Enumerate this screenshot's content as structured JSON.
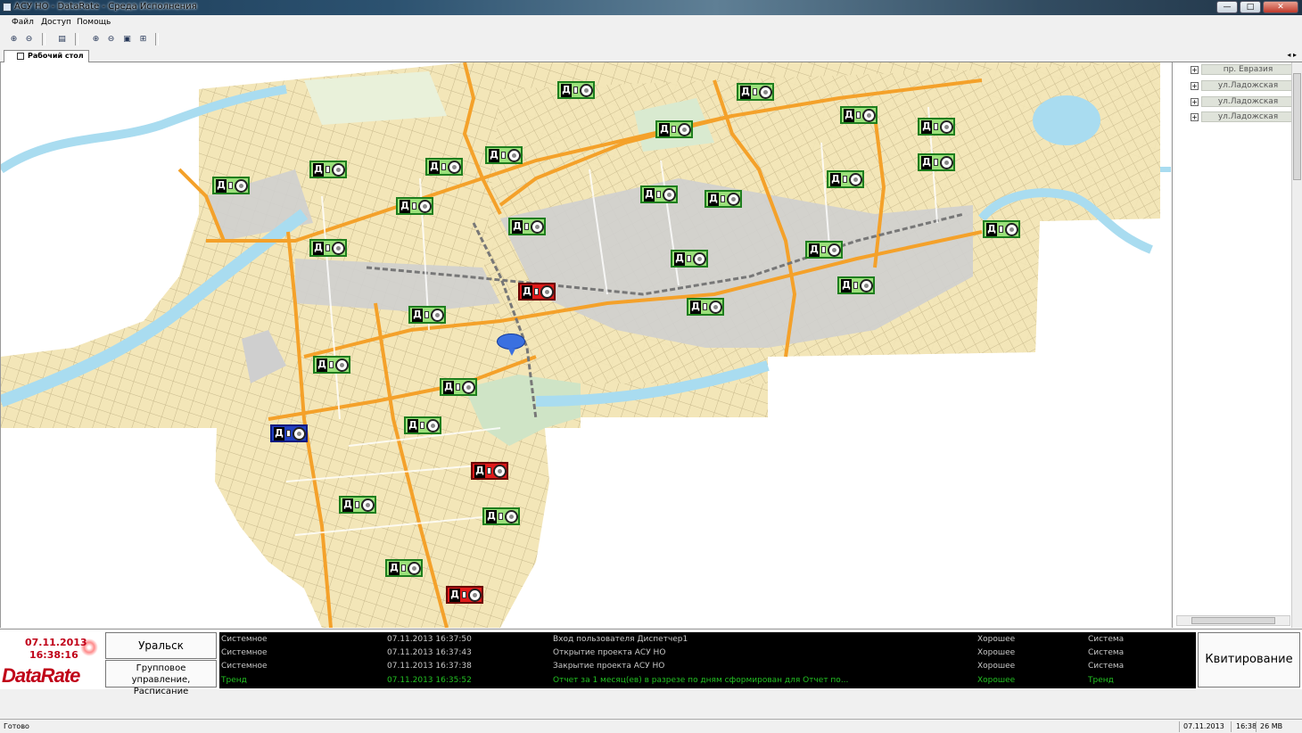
{
  "window": {
    "title": "АСУ НО - DataRate - Среда Исполнения",
    "btn_minimize": "—",
    "btn_maximize": "□",
    "btn_close": "✕"
  },
  "menu": {
    "file": "Файл",
    "access": "Доступ",
    "help": "Помощь"
  },
  "toolbar": {
    "icons": [
      "add-object-icon",
      "remove-object-icon",
      "print-icon",
      "zoom-in-icon",
      "zoom-out-icon",
      "zoom-fit-icon",
      "zoom-window-icon"
    ]
  },
  "tabs": {
    "desktop": "Рабочий стол",
    "nav": "◂ ▸"
  },
  "side_panel": {
    "items": [
      {
        "expand": "+",
        "label": "пр. Евразия"
      },
      {
        "expand": "+",
        "label": "ул.Ладожская"
      },
      {
        "expand": "+",
        "label": "ул.Ладожская"
      },
      {
        "expand": "+",
        "label": "ул.Ладожская"
      }
    ]
  },
  "map": {
    "marker_letter": "Д",
    "status_colors": {
      "green": "#9be07a",
      "red": "#e01a1a",
      "blue": "#2040c0"
    },
    "controllers": [
      {
        "status": "green"
      },
      {
        "status": "green"
      },
      {
        "status": "green"
      },
      {
        "status": "green"
      },
      {
        "status": "green"
      },
      {
        "status": "green"
      },
      {
        "status": "green"
      },
      {
        "status": "green"
      },
      {
        "status": "green"
      },
      {
        "status": "green"
      },
      {
        "status": "green"
      },
      {
        "status": "green"
      },
      {
        "status": "green"
      },
      {
        "status": "green"
      },
      {
        "status": "green"
      },
      {
        "status": "green"
      },
      {
        "status": "green"
      },
      {
        "status": "green"
      },
      {
        "status": "green"
      },
      {
        "status": "red"
      },
      {
        "status": "green"
      },
      {
        "status": "green"
      },
      {
        "status": "green"
      },
      {
        "status": "green"
      },
      {
        "status": "blue"
      },
      {
        "status": "red"
      },
      {
        "status": "green"
      },
      {
        "status": "green"
      },
      {
        "status": "green"
      },
      {
        "status": "red"
      }
    ]
  },
  "bottom": {
    "logo": {
      "date": "07.11.2013",
      "time": "16:38:16",
      "brand": "DataRate"
    },
    "city_button": "Уральск",
    "group_button_line1": "Групповое управление,",
    "group_button_line2": "Расписание",
    "acknowledge_button": "Квитирование",
    "log": [
      {
        "type": "Системное",
        "datetime": "07.11.2013 16:37:50",
        "message": "Вход пользователя Диспетчер1",
        "quality": "Хорошее",
        "source": "Система",
        "color": "#c8c8c8"
      },
      {
        "type": "Системное",
        "datetime": "07.11.2013 16:37:43",
        "message": "Открытие проекта АСУ НО",
        "quality": "Хорошее",
        "source": "Система",
        "color": "#c8c8c8"
      },
      {
        "type": "Системное",
        "datetime": "07.11.2013 16:37:38",
        "message": "Закрытие проекта АСУ НО",
        "quality": "Хорошее",
        "source": "Система",
        "color": "#c8c8c8"
      },
      {
        "type": "Тренд",
        "datetime": "07.11.2013 16:35:52",
        "message": "Отчет за 1 месяц(ев) в разрезе по дням сформирован для Отчет по...",
        "quality": "Хорошее",
        "source": "Тренд",
        "color": "#22c022"
      }
    ]
  },
  "status_bar": {
    "ready": "Готово",
    "date": "07.11.2013",
    "time": "16:38",
    "memory": "26 MB"
  }
}
